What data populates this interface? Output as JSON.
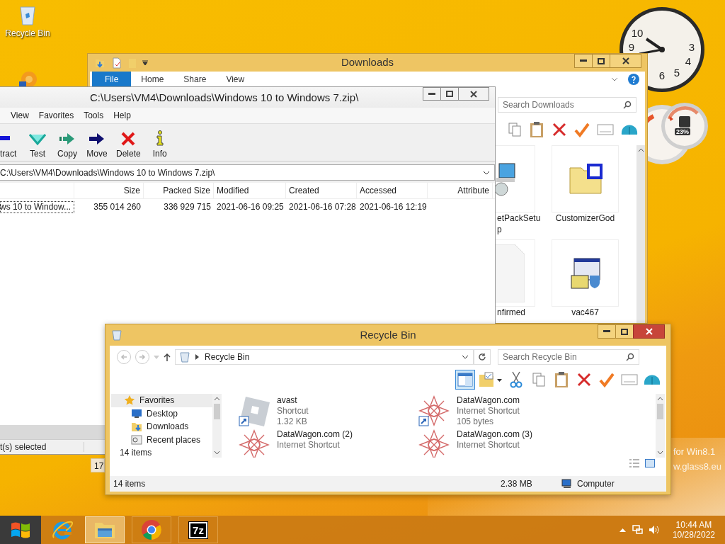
{
  "desktop": {
    "icons": [
      {
        "kind": "recycle",
        "label": "Recycle Bin"
      },
      {
        "kind": "flower"
      }
    ],
    "overlay_text": [
      "for Win8.1",
      "w.glass8.eu"
    ]
  },
  "clock_gadget": {
    "numerals": [
      "10",
      "9",
      "3",
      "4",
      "6",
      "5"
    ]
  },
  "meter_gadget": {
    "reading": "23%"
  },
  "downloads_window": {
    "title": "Downloads",
    "ribbon_tabs": [
      {
        "label": "File",
        "selected": true
      },
      {
        "label": "Home",
        "selected": false
      },
      {
        "label": "Share",
        "selected": false
      },
      {
        "label": "View",
        "selected": false
      }
    ],
    "search": {
      "placeholder": "Search Downloads"
    },
    "toolbar": [
      {
        "kind": "copy"
      },
      {
        "kind": "paste"
      },
      {
        "kind": "delete"
      },
      {
        "kind": "check"
      },
      {
        "kind": "rename"
      },
      {
        "kind": "shell"
      }
    ],
    "files": [
      {
        "kind": "installer",
        "lines": [
          "etPackSetu",
          "p"
        ]
      },
      {
        "kind": "archive-folder",
        "lines": [
          "CustomizerGod"
        ]
      },
      {
        "kind": "blank",
        "lines": [
          "nfirmed"
        ]
      },
      {
        "kind": "setup",
        "lines": [
          "vac467"
        ]
      }
    ]
  },
  "archive_window": {
    "title": "C:\\Users\\VM4\\Downloads\\Windows 10 to Windows 7.zip\\",
    "menu": [
      "View",
      "Favorites",
      "Tools",
      "Help"
    ],
    "toolbar": [
      {
        "kind": "extract",
        "label": "tract"
      },
      {
        "kind": "test",
        "label": "Test"
      },
      {
        "kind": "copy",
        "label": "Copy"
      },
      {
        "kind": "move",
        "label": "Move"
      },
      {
        "kind": "delete",
        "label": "Delete"
      },
      {
        "kind": "info",
        "label": "Info"
      }
    ],
    "path": "C:\\Users\\VM4\\Downloads\\Windows 10 to Windows 7.zip\\",
    "columns": [
      "Size",
      "Packed Size",
      "Modified",
      "Created",
      "Accessed",
      "Attribute"
    ],
    "rows": [
      {
        "name": "ws 10 to Window...",
        "cells": [
          "355 014 260",
          "336 929 715",
          "2021-06-16 09:25",
          "2021-06-16 07:28",
          "2021-06-16 12:19"
        ]
      }
    ],
    "status": "t(s) selected"
  },
  "fragment": {
    "text": "17"
  },
  "recycle_window": {
    "title": "Recycle Bin",
    "address": "Recycle Bin",
    "search": {
      "placeholder": "Search Recycle Bin"
    },
    "toolbar": [
      {
        "kind": "preview",
        "selected": true
      },
      {
        "kind": "folder-check",
        "selected": false
      },
      {
        "kind": "cut",
        "selected": false
      },
      {
        "kind": "copy",
        "selected": false
      },
      {
        "kind": "paste",
        "selected": false
      },
      {
        "kind": "delete",
        "selected": false
      },
      {
        "kind": "check",
        "selected": false
      },
      {
        "kind": "rename",
        "selected": false
      },
      {
        "kind": "shell",
        "selected": false
      }
    ],
    "nav": [
      {
        "kind": "star",
        "label": "Favorites",
        "selected": true
      },
      {
        "kind": "desktop",
        "label": "Desktop",
        "selected": false
      },
      {
        "kind": "downloads",
        "label": "Downloads",
        "selected": false
      },
      {
        "kind": "recent",
        "label": "Recent places",
        "selected": false
      }
    ],
    "items": [
      {
        "kind": "app",
        "name": "avast",
        "lines": [
          "Shortcut",
          "1.32 KB"
        ]
      },
      {
        "kind": "web",
        "name": "DataWagon.com",
        "lines": [
          "Internet Shortcut",
          "105 bytes"
        ]
      },
      {
        "kind": "web",
        "name": "DataWagon.com (2)",
        "lines": [
          "Internet Shortcut"
        ]
      },
      {
        "kind": "web",
        "name": "DataWagon.com (3)",
        "lines": [
          "Internet Shortcut"
        ]
      }
    ],
    "count": "14 items",
    "status": {
      "items": "14 items",
      "size": "2.38 MB",
      "location": "Computer"
    }
  },
  "taskbar": {
    "buttons": [
      {
        "kind": "start",
        "active": false
      },
      {
        "kind": "ie",
        "active": false
      },
      {
        "kind": "explorer",
        "active": true
      },
      {
        "kind": "chrome",
        "active": false
      },
      {
        "kind": "sevenzip",
        "label": "7z",
        "active": false
      }
    ],
    "time": "10:44 AM",
    "date": "10/28/2022"
  }
}
